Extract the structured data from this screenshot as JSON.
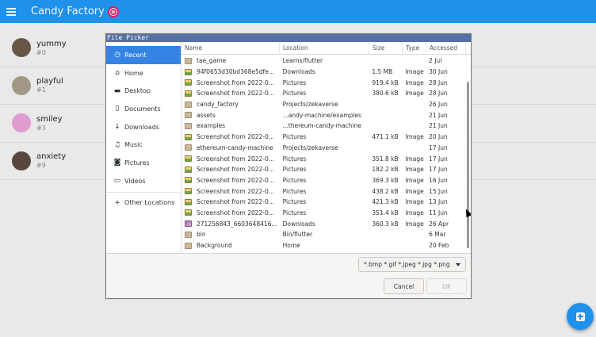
{
  "app": {
    "title": "Candy Factory",
    "accent": "#2196f3",
    "items": [
      {
        "name": "yummy",
        "id": "#0",
        "avatar_color": "#6b5a4a"
      },
      {
        "name": "playful",
        "id": "#1",
        "avatar_color": "#a89c8c"
      },
      {
        "name": "smiley",
        "id": "#3",
        "avatar_color": "#e8a0d8"
      },
      {
        "name": "anxiety",
        "id": "#9",
        "avatar_color": "#5b4a3e"
      }
    ]
  },
  "dialog": {
    "title": "File Picker",
    "places": [
      {
        "label": "Recent",
        "icon": "clock-icon",
        "glyph": "◷",
        "active": true
      },
      {
        "label": "Home",
        "icon": "home-icon",
        "glyph": "⌂"
      },
      {
        "label": "Desktop",
        "icon": "folder-icon",
        "glyph": "▬"
      },
      {
        "label": "Documents",
        "icon": "document-icon",
        "glyph": "▯"
      },
      {
        "label": "Downloads",
        "icon": "download-icon",
        "glyph": "↓"
      },
      {
        "label": "Music",
        "icon": "music-icon",
        "glyph": "♫"
      },
      {
        "label": "Pictures",
        "icon": "camera-icon",
        "glyph": "◙"
      },
      {
        "label": "Videos",
        "icon": "video-icon",
        "glyph": "▭"
      },
      {
        "label": "Other Locations",
        "icon": "plus-icon",
        "glyph": "+"
      }
    ],
    "columns": {
      "name": "Name",
      "location": "Location",
      "size": "Size",
      "type": "Type",
      "accessed": "Accessed"
    },
    "files": [
      {
        "name": "tae_game",
        "location": "Learns/flutter",
        "size": "",
        "type": "",
        "accessed": "2 Jul",
        "kind": "folder"
      },
      {
        "name": "94f0653d30bd368e5dfe...",
        "location": "Downloads",
        "size": "1.5 MB",
        "type": "Image",
        "accessed": "30 Jun",
        "kind": "image"
      },
      {
        "name": "Screenshot from 2022-0...",
        "location": "Pictures",
        "size": "919.4 kB",
        "type": "Image",
        "accessed": "28 Jun",
        "kind": "image"
      },
      {
        "name": "Screenshot from 2022-0...",
        "location": "Pictures",
        "size": "380.6 kB",
        "type": "Image",
        "accessed": "28 Jun",
        "kind": "image"
      },
      {
        "name": "candy_factory",
        "location": "Projects/zekaverse",
        "size": "",
        "type": "",
        "accessed": "26 Jun",
        "kind": "folder"
      },
      {
        "name": "assets",
        "location": "...andy-machine/examples",
        "size": "",
        "type": "",
        "accessed": "21 Jun",
        "kind": "folder"
      },
      {
        "name": "examples",
        "location": "...thereum-candy-machine",
        "size": "",
        "type": "",
        "accessed": "21 Jun",
        "kind": "folder"
      },
      {
        "name": "Screenshot from 2022-0...",
        "location": "Pictures",
        "size": "471.1 kB",
        "type": "Image",
        "accessed": "20 Jun",
        "kind": "image"
      },
      {
        "name": "ethereum-candy-machine",
        "location": "Projects/zekaverse",
        "size": "",
        "type": "",
        "accessed": "17 Jun",
        "kind": "folder"
      },
      {
        "name": "Screenshot from 2022-0...",
        "location": "Pictures",
        "size": "351.8 kB",
        "type": "Image",
        "accessed": "17 Jun",
        "kind": "image"
      },
      {
        "name": "Screenshot from 2022-0...",
        "location": "Pictures",
        "size": "182.2 kB",
        "type": "Image",
        "accessed": "17 Jun",
        "kind": "image"
      },
      {
        "name": "Screenshot from 2022-0...",
        "location": "Pictures",
        "size": "369.3 kB",
        "type": "Image",
        "accessed": "16 Jun",
        "kind": "image"
      },
      {
        "name": "Screenshot from 2022-0...",
        "location": "Pictures",
        "size": "438.2 kB",
        "type": "Image",
        "accessed": "15 Jun",
        "kind": "image"
      },
      {
        "name": "Screenshot from 2022-0...",
        "location": "Pictures",
        "size": "421.3 kB",
        "type": "Image",
        "accessed": "13 Jun",
        "kind": "image"
      },
      {
        "name": "Screenshot from 2022-0...",
        "location": "Pictures",
        "size": "351.4 kB",
        "type": "Image",
        "accessed": "11 Jun",
        "kind": "image"
      },
      {
        "name": "271256843_6603648416...",
        "location": "Downloads",
        "size": "360.3 kB",
        "type": "Image",
        "accessed": "26 Apr",
        "kind": "photo"
      },
      {
        "name": "bin",
        "location": "Bin/flutter",
        "size": "",
        "type": "",
        "accessed": "6 Mar",
        "kind": "folder"
      },
      {
        "name": "Background",
        "location": "Home",
        "size": "",
        "type": "",
        "accessed": "20 Feb",
        "kind": "folder"
      }
    ],
    "filter": "*.bmp *.gif *.jpeg *.jpg *.png",
    "cancel_label": "Cancel",
    "ok_label": "OK"
  }
}
